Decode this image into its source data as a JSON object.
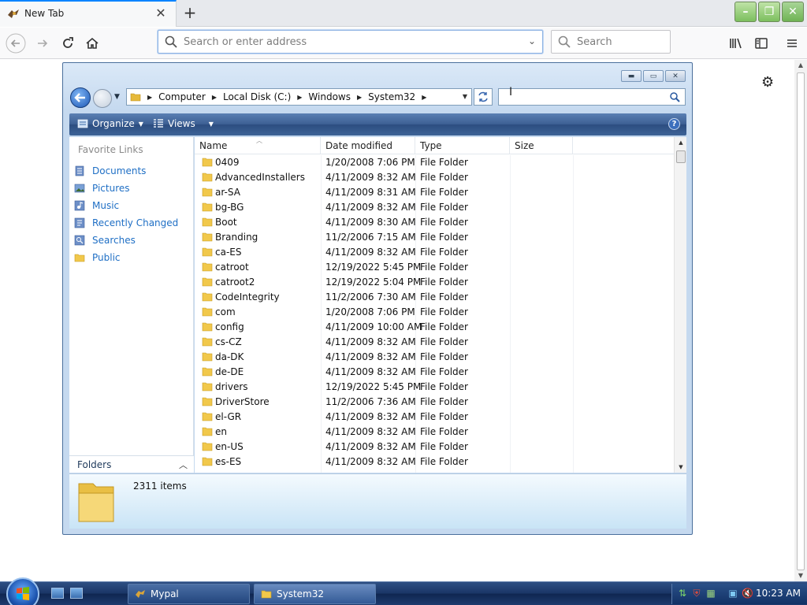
{
  "browser": {
    "tab_title": "New Tab",
    "urlbar_placeholder": "Search or enter address",
    "search_placeholder": "Search"
  },
  "explorer": {
    "breadcrumb": [
      "Computer",
      "Local Disk (C:)",
      "Windows",
      "System32"
    ],
    "toolbar": {
      "organize": "Organize",
      "views": "Views",
      "help": "?"
    },
    "favorite_links_title": "Favorite Links",
    "favorite_links": [
      {
        "label": "Documents",
        "icon": "documents-icon"
      },
      {
        "label": "Pictures",
        "icon": "pictures-icon"
      },
      {
        "label": "Music",
        "icon": "music-icon"
      },
      {
        "label": "Recently Changed",
        "icon": "recently-changed-icon"
      },
      {
        "label": "Searches",
        "icon": "searches-icon"
      },
      {
        "label": "Public",
        "icon": "folder-icon"
      }
    ],
    "folders_label": "Folders",
    "columns": [
      "Name",
      "Date modified",
      "Type",
      "Size"
    ],
    "files": [
      {
        "name": "0409",
        "date": "1/20/2008 7:06 PM",
        "type": "File Folder",
        "size": ""
      },
      {
        "name": "AdvancedInstallers",
        "date": "4/11/2009 8:32 AM",
        "type": "File Folder",
        "size": ""
      },
      {
        "name": "ar-SA",
        "date": "4/11/2009 8:31 AM",
        "type": "File Folder",
        "size": ""
      },
      {
        "name": "bg-BG",
        "date": "4/11/2009 8:32 AM",
        "type": "File Folder",
        "size": ""
      },
      {
        "name": "Boot",
        "date": "4/11/2009 8:30 AM",
        "type": "File Folder",
        "size": ""
      },
      {
        "name": "Branding",
        "date": "11/2/2006 7:15 AM",
        "type": "File Folder",
        "size": ""
      },
      {
        "name": "ca-ES",
        "date": "4/11/2009 8:32 AM",
        "type": "File Folder",
        "size": ""
      },
      {
        "name": "catroot",
        "date": "12/19/2022 5:45 PM",
        "type": "File Folder",
        "size": ""
      },
      {
        "name": "catroot2",
        "date": "12/19/2022 5:04 PM",
        "type": "File Folder",
        "size": ""
      },
      {
        "name": "CodeIntegrity",
        "date": "11/2/2006 7:30 AM",
        "type": "File Folder",
        "size": ""
      },
      {
        "name": "com",
        "date": "1/20/2008 7:06 PM",
        "type": "File Folder",
        "size": ""
      },
      {
        "name": "config",
        "date": "4/11/2009 10:00 AM",
        "type": "File Folder",
        "size": ""
      },
      {
        "name": "cs-CZ",
        "date": "4/11/2009 8:32 AM",
        "type": "File Folder",
        "size": ""
      },
      {
        "name": "da-DK",
        "date": "4/11/2009 8:32 AM",
        "type": "File Folder",
        "size": ""
      },
      {
        "name": "de-DE",
        "date": "4/11/2009 8:32 AM",
        "type": "File Folder",
        "size": ""
      },
      {
        "name": "drivers",
        "date": "12/19/2022 5:45 PM",
        "type": "File Folder",
        "size": ""
      },
      {
        "name": "DriverStore",
        "date": "11/2/2006 7:36 AM",
        "type": "File Folder",
        "size": ""
      },
      {
        "name": "el-GR",
        "date": "4/11/2009 8:32 AM",
        "type": "File Folder",
        "size": ""
      },
      {
        "name": "en",
        "date": "4/11/2009 8:32 AM",
        "type": "File Folder",
        "size": ""
      },
      {
        "name": "en-US",
        "date": "4/11/2009 8:32 AM",
        "type": "File Folder",
        "size": ""
      },
      {
        "name": "es-ES",
        "date": "4/11/2009 8:32 AM",
        "type": "File Folder",
        "size": ""
      }
    ],
    "status_count": "2311 items"
  },
  "taskbar": {
    "buttons": [
      {
        "label": "Mypal",
        "icon": "mypal-icon",
        "active": false
      },
      {
        "label": "System32",
        "icon": "folder-icon",
        "active": true
      }
    ],
    "clock": "10:23 AM"
  },
  "colors": {
    "link_blue": "#1f6fc5",
    "folder_yellow": "#f1c84b",
    "taskbar": "#1a3566"
  }
}
